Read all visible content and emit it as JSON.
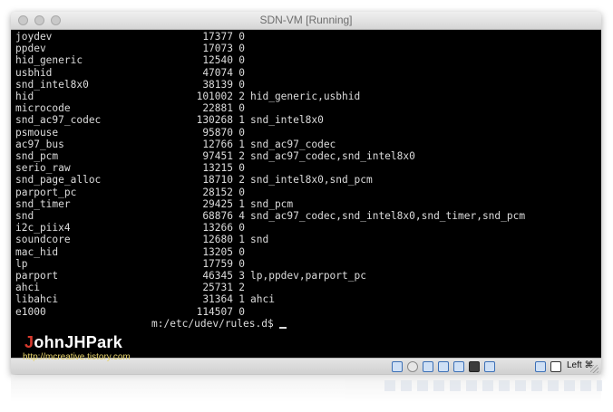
{
  "window": {
    "title": "SDN-VM [Running]"
  },
  "terminal": {
    "rows": [
      {
        "name": "joydev",
        "size": "17377",
        "used": "0",
        "by": ""
      },
      {
        "name": "ppdev",
        "size": "17073",
        "used": "0",
        "by": ""
      },
      {
        "name": "hid_generic",
        "size": "12540",
        "used": "0",
        "by": ""
      },
      {
        "name": "usbhid",
        "size": "47074",
        "used": "0",
        "by": ""
      },
      {
        "name": "snd_intel8x0",
        "size": "38139",
        "used": "0",
        "by": ""
      },
      {
        "name": "hid",
        "size": "101002",
        "used": "2",
        "by": "hid_generic,usbhid"
      },
      {
        "name": "microcode",
        "size": "22881",
        "used": "0",
        "by": ""
      },
      {
        "name": "snd_ac97_codec",
        "size": "130268",
        "used": "1",
        "by": "snd_intel8x0"
      },
      {
        "name": "psmouse",
        "size": "95870",
        "used": "0",
        "by": ""
      },
      {
        "name": "ac97_bus",
        "size": "12766",
        "used": "1",
        "by": "snd_ac97_codec"
      },
      {
        "name": "snd_pcm",
        "size": "97451",
        "used": "2",
        "by": "snd_ac97_codec,snd_intel8x0"
      },
      {
        "name": "serio_raw",
        "size": "13215",
        "used": "0",
        "by": ""
      },
      {
        "name": "snd_page_alloc",
        "size": "18710",
        "used": "2",
        "by": "snd_intel8x0,snd_pcm"
      },
      {
        "name": "parport_pc",
        "size": "28152",
        "used": "0",
        "by": ""
      },
      {
        "name": "snd_timer",
        "size": "29425",
        "used": "1",
        "by": "snd_pcm"
      },
      {
        "name": "snd",
        "size": "68876",
        "used": "4",
        "by": "snd_ac97_codec,snd_intel8x0,snd_timer,snd_pcm"
      },
      {
        "name": "i2c_piix4",
        "size": "13266",
        "used": "0",
        "by": ""
      },
      {
        "name": "soundcore",
        "size": "12680",
        "used": "1",
        "by": "snd"
      },
      {
        "name": "mac_hid",
        "size": "13205",
        "used": "0",
        "by": ""
      },
      {
        "name": "lp",
        "size": "17759",
        "used": "0",
        "by": ""
      },
      {
        "name": "parport",
        "size": "46345",
        "used": "3",
        "by": "lp,ppdev,parport_pc"
      },
      {
        "name": "ahci",
        "size": "25731",
        "used": "2",
        "by": ""
      },
      {
        "name": "libahci",
        "size": "31364",
        "used": "1",
        "by": "ahci"
      },
      {
        "name": "e1000",
        "size": "114507",
        "used": "0",
        "by": ""
      }
    ],
    "prompt": "m:/etc/udev/rules.d$"
  },
  "statusbar": {
    "icons": [
      "hard-disk-icon",
      "optical-drive-icon",
      "usb-icon",
      "shared-folders-icon",
      "display-icon",
      "network-icon",
      "video-capture-icon",
      "mouse-integration-icon",
      "keyboard-capture-icon"
    ],
    "host_key": "Left ⌘"
  },
  "watermark": {
    "first": "J",
    "rest": "ohnJHPark",
    "url": "http://mcreative.tistory.com"
  },
  "colors": {
    "terminal_bg": "#000000",
    "terminal_fg": "#dcdcdc",
    "watermark_j": "#d83a2e"
  }
}
